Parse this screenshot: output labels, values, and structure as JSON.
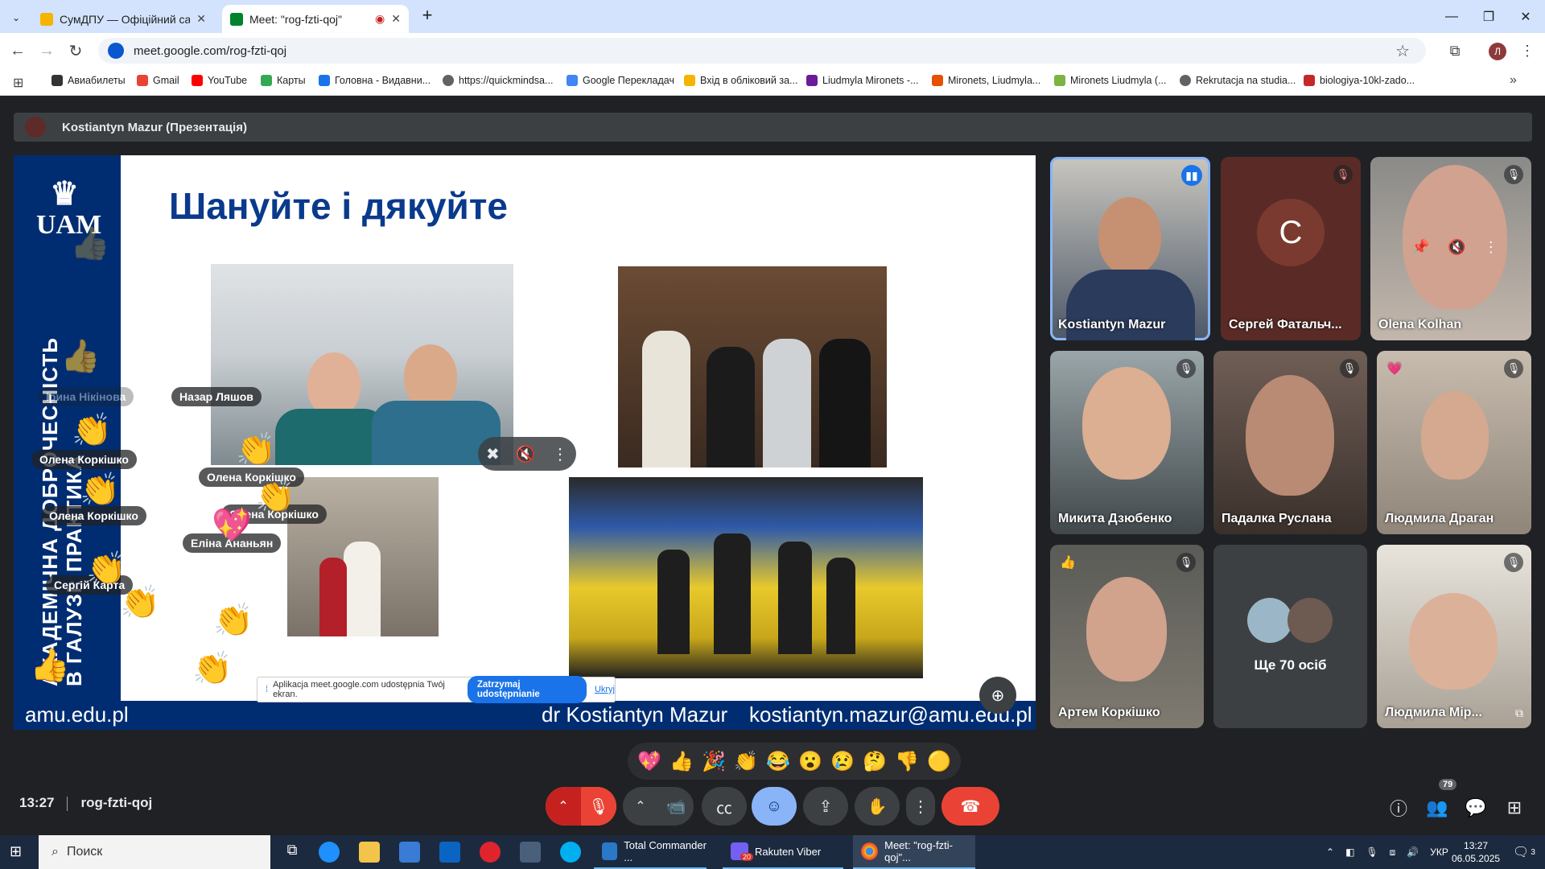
{
  "browser": {
    "tabs": [
      {
        "title": "СумДПУ — Офіційний сайт Су",
        "active": false,
        "favicon_color": "#f4b400"
      },
      {
        "title": "Meet: \"rog-fzti-qoj\"",
        "active": true,
        "favicon_color": "#00832d"
      }
    ],
    "url": "meet.google.com/rog-fzti-qoj",
    "bookmarks": [
      {
        "label": "Авиабилеты",
        "color": "#333333"
      },
      {
        "label": "Gmail",
        "color": "#ea4335"
      },
      {
        "label": "YouTube",
        "color": "#ff0000"
      },
      {
        "label": "Карты",
        "color": "#34a853"
      },
      {
        "label": "Головна - Видавни...",
        "color": "#1a73e8"
      },
      {
        "label": "https://quickmindsa...",
        "color": "#5f6368"
      },
      {
        "label": "Google Перекладач",
        "color": "#4285f4"
      },
      {
        "label": "Вхід в обліковий за...",
        "color": "#f4b400"
      },
      {
        "label": "Liudmyla Mironets -...",
        "color": "#6a1b9a"
      },
      {
        "label": "Mironets, Liudmyla...",
        "color": "#e65100"
      },
      {
        "label": "Mironets Liudmyla (...",
        "color": "#7cb342"
      },
      {
        "label": "Rekrutacja na studia...",
        "color": "#5f6368"
      },
      {
        "label": "biologiya-10kl-zado...",
        "color": "#c62828"
      }
    ]
  },
  "meet": {
    "presenter": "Kostiantyn Mazur (Презентація)",
    "slide": {
      "logo": "UAM",
      "vertical_text_line1": "АКАДЕМІЧНА ДОБРОЧЕСНІСТЬ",
      "vertical_text_line2": "В ГАЛУЗІ: ПРАКТИКА",
      "title": "Шануйте і дякуйте",
      "footer_site": "amu.edu.pl",
      "footer_name": "dr Kostiantyn Mazur",
      "footer_email": "kostiantyn.mazur@amu.edu.pl"
    },
    "share_bar": {
      "text": "Aplikacja meet.google.com udostępnia Twój ekran.",
      "stop": "Zatrzymaj udostępnianie",
      "hide": "Ukryj"
    },
    "floating_names": [
      "Назар Ляшов",
      "Ірина Нікінова",
      "Олена Коркішко",
      "Олена Коркішко",
      "Олена Коркішко",
      "Олена Коркішко",
      "Еліна Ананьян",
      "Сергій Карта"
    ],
    "participants": [
      {
        "name": "Kostiantyn Mazur",
        "initial": "",
        "bg": "#6b7a8c"
      },
      {
        "name": "Сергей Фатальч...",
        "initial": "C",
        "bg": "#5a2b26"
      },
      {
        "name": "Olena Kolhan",
        "initial": "",
        "bg": "#9a8f88"
      },
      {
        "name": "Микита Дзюбенко",
        "initial": "",
        "bg": "#7b8a8e"
      },
      {
        "name": "Падалка Руслана",
        "initial": "",
        "bg": "#5c4b44"
      },
      {
        "name": "Людмила Драган",
        "initial": "",
        "bg": "#a79a8c"
      },
      {
        "name": "Артем Коркішко",
        "initial": "",
        "bg": "#6f6a63"
      },
      {
        "name": "Ще 70 осіб",
        "initial": "",
        "bg": "#3c4043"
      },
      {
        "name": "Людмила Мір...",
        "initial": "",
        "bg": "#c9c2b7"
      }
    ],
    "reactions": [
      "💖",
      "👍",
      "🎉",
      "👏",
      "😂",
      "😮",
      "😢",
      "🤔",
      "👎",
      "🟡"
    ],
    "time": "13:27",
    "code": "rog-fzti-qoj",
    "participant_count": "79"
  },
  "taskbar": {
    "search": "Поиск",
    "apps": [
      "Total Commander ...",
      "Rakuten Viber",
      "Meet: \"rog-fzti-qoj\"..."
    ],
    "viber_badge": "20",
    "lang": "УКР",
    "time": "13:27",
    "date": "06.05.2025",
    "notif": "3"
  }
}
